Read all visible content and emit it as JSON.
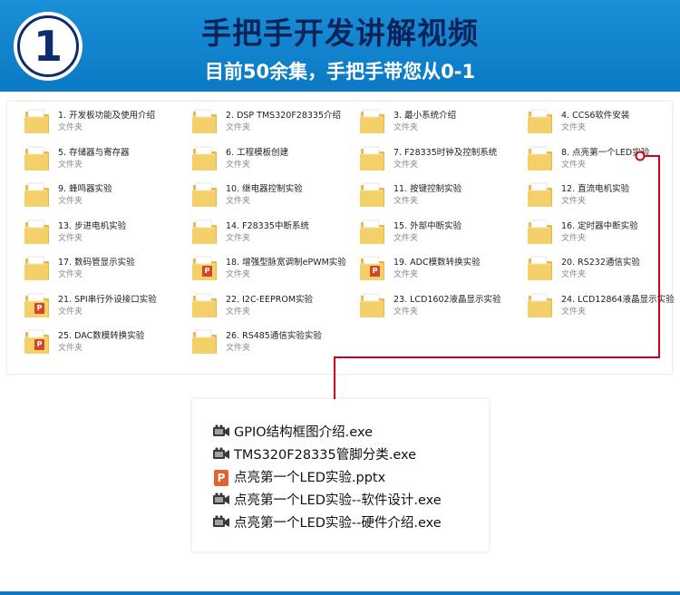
{
  "banner": {
    "badge_number": "1",
    "title": "手把手开发讲解视频",
    "subtitle": "目前50余集，手把手带您从0-1"
  },
  "folder_window": {
    "type_label": "文件夹",
    "items": [
      {
        "name": "1. 开发板功能及使用介绍",
        "icon": "folder-icon"
      },
      {
        "name": "2. DSP TMS320F28335介绍",
        "icon": "folder-icon"
      },
      {
        "name": "3. 最小系统介绍",
        "icon": "folder-icon"
      },
      {
        "name": "4. CCS6软件安装",
        "icon": "folder-icon"
      },
      {
        "name": "5. 存储器与寄存器",
        "icon": "folder-icon"
      },
      {
        "name": "6. 工程模板创建",
        "icon": "folder-icon"
      },
      {
        "name": "7. F28335时钟及控制系统",
        "icon": "folder-icon"
      },
      {
        "name": "8. 点亮第一个LED实验",
        "icon": "folder-icon"
      },
      {
        "name": "9. 蜂鸣器实验",
        "icon": "folder-icon"
      },
      {
        "name": "10. 继电器控制实验",
        "icon": "folder-icon"
      },
      {
        "name": "11. 按键控制实验",
        "icon": "folder-icon"
      },
      {
        "name": "12. 直流电机实验",
        "icon": "folder-icon"
      },
      {
        "name": "13. 步进电机实验",
        "icon": "folder-icon"
      },
      {
        "name": "14. F28335中断系统",
        "icon": "folder-icon"
      },
      {
        "name": "15. 外部中断实验",
        "icon": "folder-icon"
      },
      {
        "name": "16. 定时器中断实验",
        "icon": "folder-icon"
      },
      {
        "name": "17. 数码管显示实验",
        "icon": "folder-icon"
      },
      {
        "name": "18. 增强型脉宽调制ePWM实验",
        "icon": "folder-ppt-icon"
      },
      {
        "name": "19. ADC模数转换实验",
        "icon": "folder-ppt-icon"
      },
      {
        "name": "20. RS232通信实验",
        "icon": "folder-icon"
      },
      {
        "name": "21. SPI串行外设接口实验",
        "icon": "folder-ppt-icon"
      },
      {
        "name": "22. I2C-EEPROM实验",
        "icon": "folder-icon"
      },
      {
        "name": "23. LCD1602液晶显示实验",
        "icon": "folder-icon"
      },
      {
        "name": "24. LCD12864液晶显示实验",
        "icon": "folder-icon"
      },
      {
        "name": "25. DAC数模转换实验",
        "icon": "folder-ppt-icon"
      },
      {
        "name": "26. RS485通信实验实验",
        "icon": "folder-icon"
      }
    ]
  },
  "file_list": {
    "items": [
      {
        "name": "GPIO结构框图介绍.exe",
        "icon": "video-exe-icon"
      },
      {
        "name": "TMS320F28335管脚分类.exe",
        "icon": "video-exe-icon"
      },
      {
        "name": "点亮第一个LED实验.pptx",
        "icon": "pptx-icon"
      },
      {
        "name": "点亮第一个LED实验--软件设计.exe",
        "icon": "video-exe-icon"
      },
      {
        "name": "点亮第一个LED实验--硬件介绍.exe",
        "icon": "video-exe-icon"
      }
    ]
  },
  "colors": {
    "banner_blue": "#0b79c4",
    "title_navy": "#0a2359",
    "connector_red": "#d0021b",
    "folder_yellow": "#f3d06a"
  }
}
